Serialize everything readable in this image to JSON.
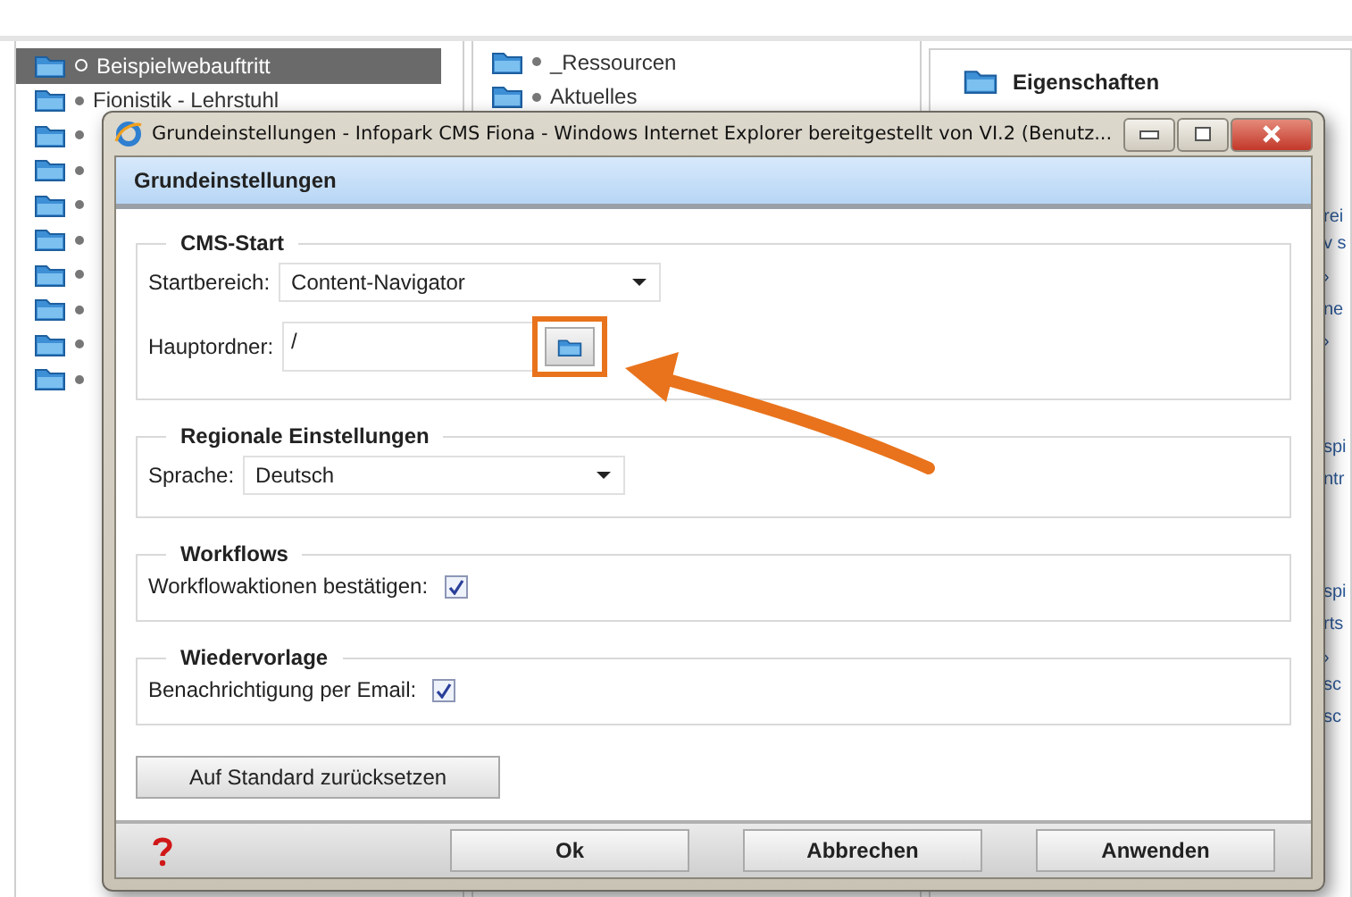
{
  "background": {
    "left_tree": {
      "items": [
        {
          "label": "Beispielwebauftritt",
          "selected": true
        },
        {
          "label": "Fionistik - Lehrstuhl",
          "selected": false
        },
        {
          "selected": false
        },
        {
          "selected": false
        },
        {
          "selected": false
        },
        {
          "selected": false
        },
        {
          "selected": false
        },
        {
          "selected": false
        },
        {
          "selected": false
        },
        {
          "selected": false
        }
      ]
    },
    "middle_list": {
      "items": [
        "_Ressourcen",
        "Aktuelles"
      ]
    },
    "right_panel": {
      "title": "Eigenschaften",
      "fragments": [
        "rei",
        "v s",
        "›",
        "ne",
        "›",
        "spi",
        "ntr",
        "spi",
        "rts",
        "›",
        "sc",
        "sc"
      ]
    }
  },
  "dialog": {
    "window_title": "Grundeinstellungen - Infopark CMS Fiona - Windows Internet Explorer bereitgestellt von VI.2 (Benutz...",
    "header": "Grundeinstellungen",
    "sections": [
      {
        "title": "CMS-Start",
        "fields": [
          {
            "kind": "select",
            "label": "Startbereich:",
            "value": "Content-Navigator"
          },
          {
            "kind": "folder",
            "label": "Hauptordner:",
            "value": "/",
            "highlighted": true
          }
        ]
      },
      {
        "title": "Regionale Einstellungen",
        "fields": [
          {
            "kind": "select",
            "label": "Sprache:",
            "value": "Deutsch"
          }
        ]
      },
      {
        "title": "Workflows",
        "fields": [
          {
            "kind": "checkbox",
            "label": "Workflowaktionen bestätigen:",
            "checked": true
          }
        ]
      },
      {
        "title": "Wiedervorlage",
        "fields": [
          {
            "kind": "checkbox",
            "label": "Benachrichtigung per Email:",
            "checked": true
          }
        ]
      }
    ],
    "reset_button": "Auf Standard zurücksetzen",
    "footer_buttons": [
      "Ok",
      "Abbrechen",
      "Anwenden"
    ]
  }
}
